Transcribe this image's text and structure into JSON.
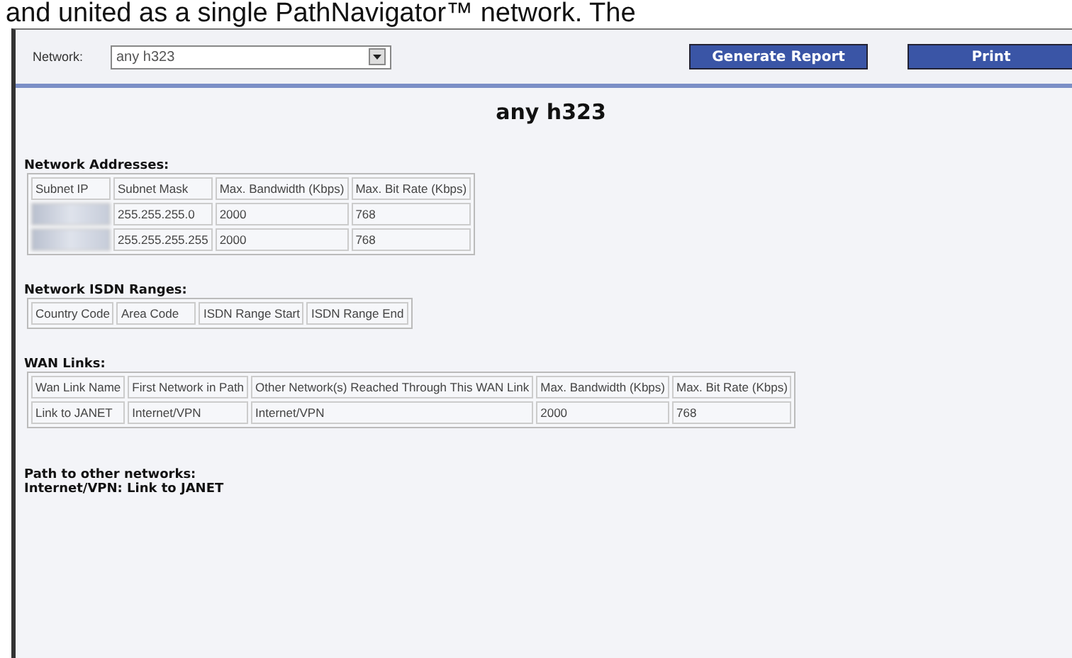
{
  "document_text": "and united as a single PathNavigator™ network. The",
  "toolbar": {
    "network_label": "Network:",
    "network_value": "any h323",
    "buttons": [
      "Generate Report",
      "Print"
    ]
  },
  "title": "any h323",
  "network_addresses": {
    "heading": "Network Addresses:",
    "columns": [
      "Subnet IP",
      "Subnet Mask",
      "Max. Bandwidth (Kbps)",
      "Max. Bit Rate (Kbps)"
    ],
    "rows": [
      {
        "subnet_ip": {
          "kind": "redacted"
        },
        "subnet_mask": "255.255.255.0",
        "bandwidth": "2000",
        "bit_rate": "768"
      },
      {
        "subnet_ip": {
          "kind": "redacted"
        },
        "subnet_mask": "255.255.255.255",
        "bandwidth": "2000",
        "bit_rate": "768"
      }
    ]
  },
  "isdn_ranges": {
    "heading": "Network ISDN Ranges:",
    "columns": [
      "Country Code",
      "Area Code",
      "ISDN Range Start",
      "ISDN Range End"
    ]
  },
  "wan_links": {
    "heading": "WAN Links:",
    "columns": [
      "Wan Link Name",
      "First Network in Path",
      "Other Network(s) Reached Through This WAN Link",
      "Max. Bandwidth (Kbps)",
      "Max. Bit Rate (Kbps)"
    ],
    "rows": [
      [
        "Link to JANET",
        "Internet/VPN",
        "Internet/VPN",
        "2000",
        "768"
      ]
    ]
  },
  "paths": {
    "heading": "Path to other networks:",
    "lines": [
      "Internet/VPN: Link to JANET"
    ]
  }
}
